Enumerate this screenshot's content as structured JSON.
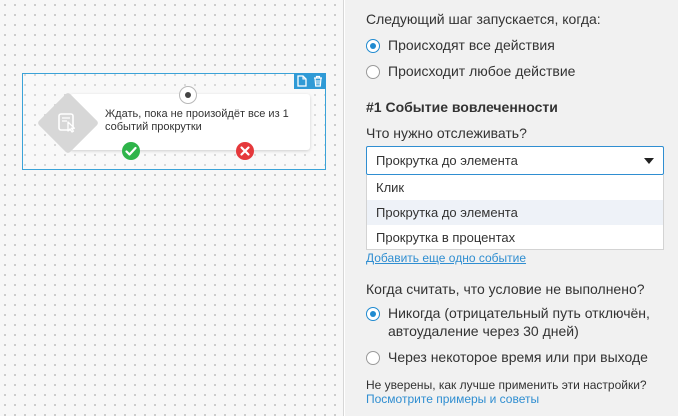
{
  "canvas": {
    "block_text": "Ждать, пока не произойдёт все из 1 событий прокрутки",
    "icons": [
      "file-icon",
      "trash-icon",
      "scroll-click-icon",
      "check-icon",
      "cross-icon"
    ]
  },
  "panel": {
    "next_step_label": "Следующий шаг запускается, когда:",
    "trigger_options": [
      {
        "label": "Происходят все действия",
        "checked": true
      },
      {
        "label": "Происходит любое действие",
        "checked": false
      }
    ],
    "event_title": "#1 Событие вовлеченности",
    "track_label": "Что нужно отслеживать?",
    "select": {
      "value": "Прокрутка до элемента",
      "options": [
        "Клик",
        "Прокрутка до элемента",
        "Прокрутка в процентах"
      ],
      "highlighted": "Прокрутка до элемента"
    },
    "add_event_link": "Добавить еще одно событие",
    "fail_label": "Когда считать, что условие не выполнено?",
    "fail_options": [
      {
        "label_line1": "Никогда (отрицательный путь отключён,",
        "label_line2": "автоудаление через 30 дней)",
        "checked": true
      },
      {
        "label_line1": "Через некоторое время или при выходе",
        "checked": false
      }
    ],
    "help_text": "Не уверены, как лучше применить эти настройки?",
    "help_link": "Посмотрите примеры и советы"
  },
  "colors": {
    "accent": "#1f8ad0",
    "success": "#2eb44a",
    "danger": "#e5383b",
    "panel_bg": "#f1f1f1"
  }
}
